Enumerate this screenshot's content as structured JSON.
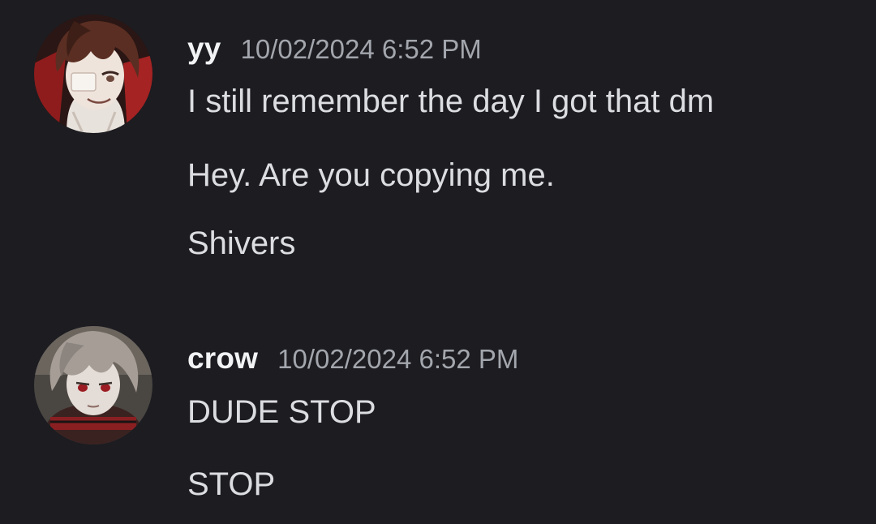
{
  "messages": [
    {
      "username": "yy",
      "timestamp": "10/02/2024 6:52 PM",
      "avatar_icon": "user-avatar-brown-hair",
      "lines": [
        "I still remember the day I got that dm",
        "Hey. Are you copying me.",
        "Shivers"
      ]
    },
    {
      "username": "crow",
      "timestamp": "10/02/2024 6:52 PM",
      "avatar_icon": "user-avatar-gray-hair",
      "lines": [
        "DUDE STOP",
        "STOP"
      ]
    }
  ],
  "colors": {
    "background": "#1c1c21",
    "username": "#f2f3f5",
    "timestamp": "#a3a6ad",
    "message_text": "#dcdde1"
  }
}
